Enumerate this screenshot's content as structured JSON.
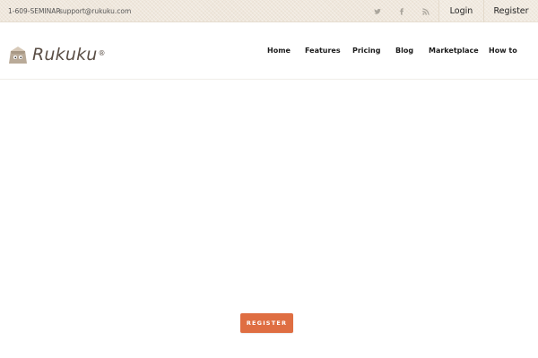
{
  "topbar": {
    "phone": "1-609-SEMINAR",
    "email": "support@rukuku.com",
    "social": [
      {
        "icon": "twitter-icon"
      },
      {
        "icon": "facebook-icon"
      },
      {
        "icon": "rss-icon"
      }
    ],
    "login_label": "Login",
    "register_label": "Register"
  },
  "header": {
    "logo_text": "Rukuku",
    "logo_mark": "®",
    "nav": [
      {
        "label": "Home"
      },
      {
        "label": "Features"
      },
      {
        "label": "Pricing"
      },
      {
        "label": "Blog"
      },
      {
        "label": "Marketplace"
      },
      {
        "label": "How to"
      }
    ]
  },
  "hero": {
    "cta_label": "REGISTER"
  },
  "colors": {
    "accent": "#df6e42",
    "topbar_bg": "#efe7dc",
    "logo_text": "#5a4e45"
  }
}
